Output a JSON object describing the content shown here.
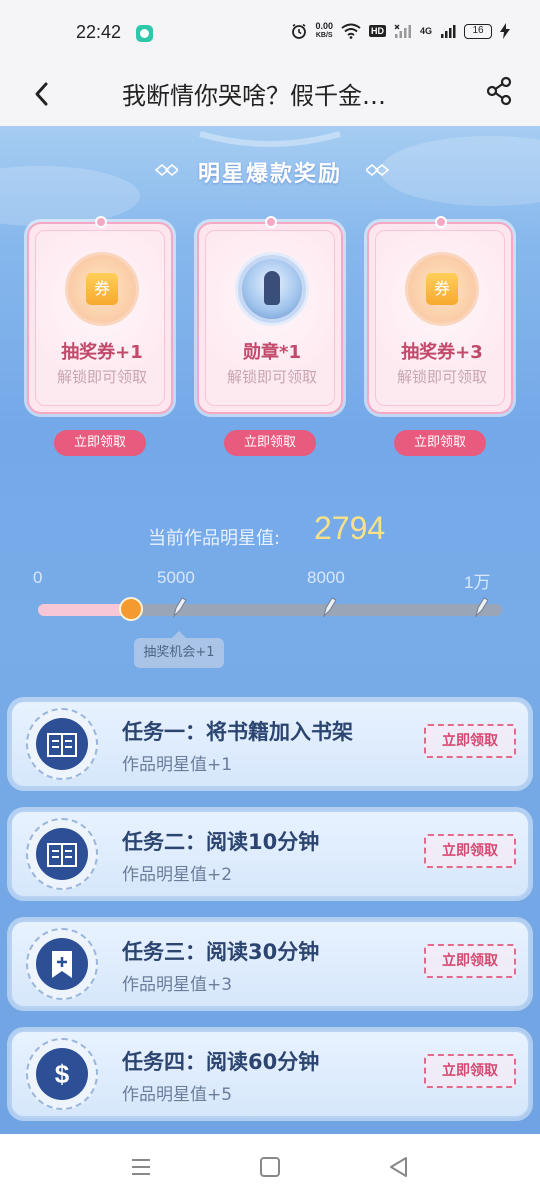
{
  "status_bar": {
    "time": "22:42",
    "net_speed": "0.00",
    "net_unit": "KB/S",
    "hd": "HD",
    "signal_type": "4G",
    "battery": "16",
    "icons": [
      "alarm-icon",
      "wifi-icon",
      "signal-icon",
      "battery-icon",
      "charging-icon"
    ]
  },
  "nav": {
    "title": "我断情你哭啥？假千金…",
    "back_icon": "chevron-left-icon",
    "share_icon": "share-icon"
  },
  "rewards": {
    "title": "明星爆款奖励",
    "cards": [
      {
        "name": "抽奖券+1",
        "sub": "解锁即可领取",
        "icon": "ticket-icon",
        "icon_text": "券",
        "claim": "立即领取"
      },
      {
        "name": "勋章*1",
        "sub": "解锁即可领取",
        "icon": "medal-icon",
        "claim": "立即领取"
      },
      {
        "name": "抽奖券+3",
        "sub": "解锁即可领取",
        "icon": "ticket-icon",
        "icon_text": "券",
        "claim": "立即领取"
      }
    ]
  },
  "progress": {
    "label": "当前作品明星值:",
    "value": "2794",
    "ticks": [
      "0",
      "5000",
      "8000",
      "1万"
    ],
    "fraction": 0.2,
    "tooltip": "抽奖机会+1"
  },
  "tasks": [
    {
      "title": "任务一：将书籍加入书架",
      "sub": "作品明星值+1",
      "icon": "book-icon",
      "button": "立即领取"
    },
    {
      "title": "任务二：阅读10分钟",
      "sub": "作品明星值+2",
      "icon": "book-icon",
      "button": "立即领取"
    },
    {
      "title": "任务三：阅读30分钟",
      "sub": "作品明星值+3",
      "icon": "bookmark-plus-icon",
      "button": "立即领取"
    },
    {
      "title": "任务四：阅读60分钟",
      "sub": "作品明星值+5",
      "icon": "dollar-icon",
      "button": "立即领取"
    }
  ],
  "colors": {
    "accent_pink": "#e85a7e",
    "value_yellow": "#fbe08a",
    "task_title": "#2c4570",
    "bg_blue": "#78ace8"
  },
  "system_nav": {
    "icons": [
      "menu-icon",
      "home-icon",
      "back-icon"
    ]
  }
}
